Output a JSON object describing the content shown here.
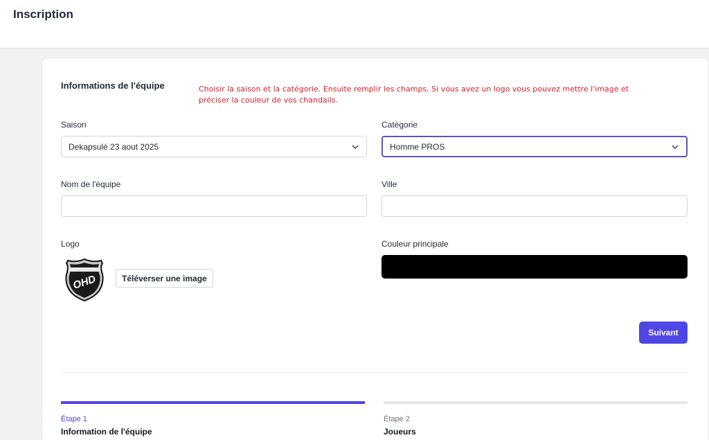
{
  "page": {
    "title": "Inscription"
  },
  "section": {
    "title": "Informations de l'équipe"
  },
  "annotation": {
    "text": "Choisir la saison et la catégorie. Ensuite remplir les champs. Si vous avez un logo vous pouvez mettre l'image et préciser la couleur de vos chandails.",
    "color": "#d8202a"
  },
  "fields": {
    "saison": {
      "label": "Saison",
      "value": "Dekapsulé 23 aout 2025"
    },
    "categorie": {
      "label": "Catégorie",
      "value": "Homme PROS"
    },
    "nom": {
      "label": "Nom de l'équipe",
      "value": "",
      "placeholder": ""
    },
    "ville": {
      "label": "Ville",
      "value": "",
      "placeholder": ""
    },
    "logo": {
      "label": "Logo",
      "upload_label": "Téléverser une image",
      "logo_text": "OHD"
    },
    "couleur": {
      "label": "Couleur principale",
      "value": "#000000"
    }
  },
  "actions": {
    "next_label": "Suivant"
  },
  "steps": [
    {
      "label": "Étape 1",
      "name": "Information de l'équipe",
      "active": true
    },
    {
      "label": "Étape 2",
      "name": "Joueurs",
      "active": false
    }
  ],
  "colors": {
    "accent": "#4f46e5",
    "step_inactive": "#e5e7eb",
    "annotation": "#d8202a"
  }
}
